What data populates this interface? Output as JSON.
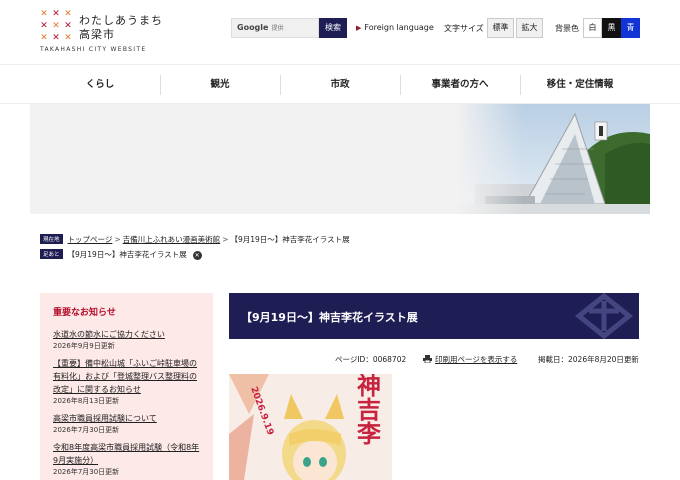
{
  "header": {
    "logo_line1": "わたしあうまち",
    "logo_line2": "高梁市",
    "logo_en": "TAKAHASHI CITY WEBSITE",
    "search": {
      "brand": "Google",
      "placeholder": "提供",
      "button": "検索"
    },
    "foreign_language": "Foreign language",
    "text_size": {
      "label": "文字サイズ",
      "standard": "標準",
      "large": "拡大"
    },
    "background": {
      "label": "背景色",
      "white": "白",
      "black": "黒",
      "blue": "青"
    },
    "colors": {
      "navy": "#1e1e55",
      "accent_red": "#b3122e",
      "orange": "#e8742a"
    }
  },
  "nav": {
    "items": [
      {
        "label": "くらし"
      },
      {
        "label": "観光"
      },
      {
        "label": "市政"
      },
      {
        "label": "事業者の方へ"
      },
      {
        "label": "移住・定住情報"
      }
    ]
  },
  "breadcrumb": {
    "current_badge": "現在地",
    "links": [
      "トップページ",
      "吉備川上ふれあい漫画美術館"
    ],
    "current": "【9月19日～】神吉李花イラスト展",
    "history_badge": "足あと",
    "history_item": "【9月19日～】神吉李花イラスト展"
  },
  "side": {
    "title": "重要なお知らせ",
    "items": [
      {
        "text": "水道水の節水にご協力ください",
        "date": "2026年9月9日更新"
      },
      {
        "text": "【重要】備中松山城「ふいご峠駐車場の有料化」および「登城整理バス整理料の改定」に関するお知らせ",
        "date": "2026年8月13日更新"
      },
      {
        "text": "高梁市職員採用試験について",
        "date": "2026年7月30日更新"
      },
      {
        "text": "令和8年度高梁市職員採用試験（令和8年9月実施分）",
        "date": "2026年7月30日更新"
      }
    ]
  },
  "main": {
    "title": "【9月19日～】神吉李花イラスト展",
    "page_id": "ページID：0068702",
    "print_link": "印刷用ページを表示する",
    "updated": "掲載日：2026年8月20日更新",
    "poster_date": "2026.9.19",
    "poster_title": "神吉李"
  }
}
